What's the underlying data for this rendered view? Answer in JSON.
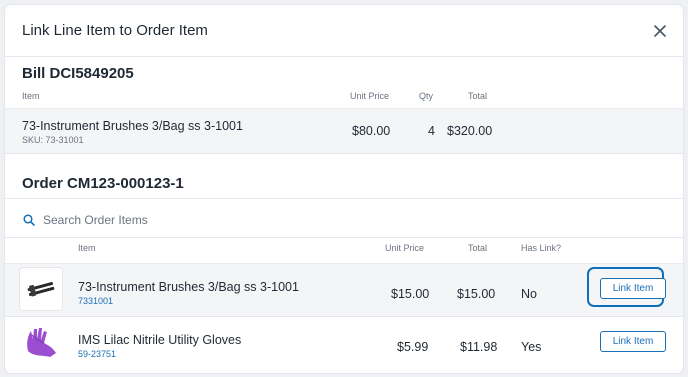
{
  "modal": {
    "title": "Link Line Item to Order Item"
  },
  "bill": {
    "title": "Bill DCI5849205",
    "headers": {
      "item": "Item",
      "unit_price": "Unit Price",
      "qty": "Qty",
      "total": "Total"
    },
    "rows": [
      {
        "name": "73-Instrument Brushes 3/Bag ss 3-1001",
        "sku": "SKU: 73-31001",
        "unit_price": "$80.00",
        "qty": "4",
        "total": "$320.00"
      }
    ]
  },
  "order": {
    "title": "Order CM123-000123-1",
    "search": {
      "placeholder": "Search Order Items",
      "value": ""
    },
    "headers": {
      "item": "Item",
      "unit_price": "Unit Price",
      "total": "Total",
      "has_link": "Has Link?"
    },
    "rows": [
      {
        "name": "73-Instrument Brushes 3/Bag ss 3-1001",
        "sku": "7331001",
        "unit_price": "$15.00",
        "total": "$15.00",
        "has_link": "No",
        "action": "Link Item",
        "thumbnail": "instrument-brushes-image"
      },
      {
        "name": "IMS Lilac Nitrile Utility Gloves",
        "sku": "59-23751",
        "unit_price": "$5.99",
        "total": "$11.98",
        "has_link": "Yes",
        "action": "Link Item",
        "thumbnail": "lilac-gloves-image"
      }
    ]
  },
  "icons": {
    "close": "close-icon",
    "search": "search-icon"
  },
  "colors": {
    "accent": "#1a6fb5",
    "row_bg": "#f4f5f7",
    "text": "#1f2933",
    "muted": "#6b7480"
  }
}
